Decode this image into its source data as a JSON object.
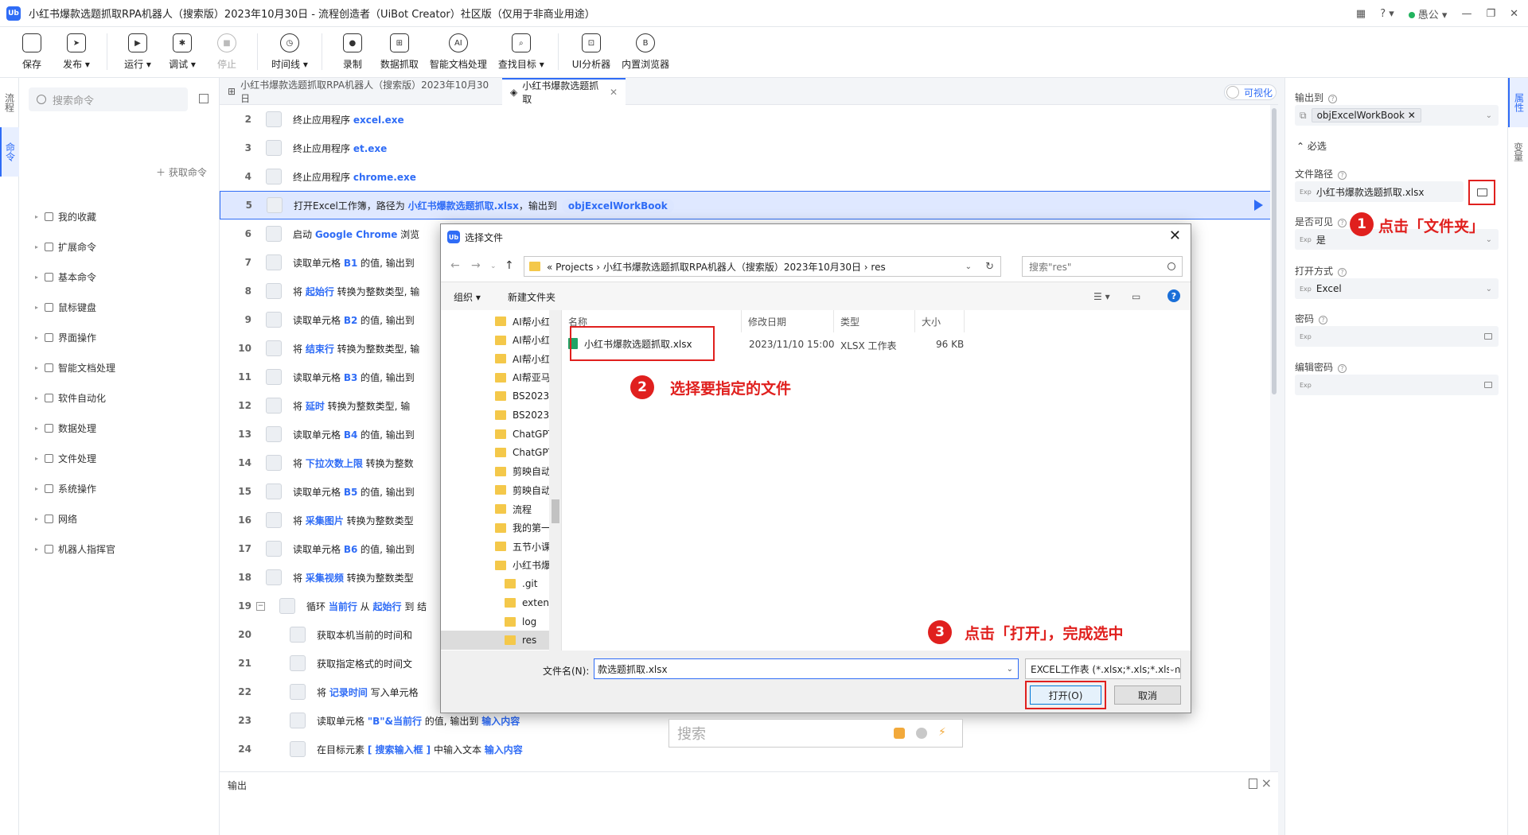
{
  "window": {
    "title": "小红书爆款选题抓取RPA机器人（搜索版）2023年10月30日 - 流程创造者（UiBot Creator）社区版（仅用于非商业用途）",
    "logo": "Ub",
    "user": "愚公"
  },
  "toolbar": {
    "save": "保存",
    "publish": "发布",
    "run": "运行",
    "debug": "调试",
    "stop": "停止",
    "timeline": "时间线",
    "record": "录制",
    "data_capture": "数据抓取",
    "smart_doc": "智能文档处理",
    "find_target": "查找目标",
    "ui_analyzer": "UI分析器",
    "builtin_browser": "内置浏览器"
  },
  "left_strip": {
    "flow": "流程",
    "commands": "命令"
  },
  "command_panel": {
    "search_placeholder": "搜索命令",
    "get_commands": "获取命令",
    "items": [
      "我的收藏",
      "扩展命令",
      "基本命令",
      "鼠标键盘",
      "界面操作",
      "智能文档处理",
      "软件自动化",
      "数据处理",
      "文件处理",
      "系统操作",
      "网络",
      "机器人指挥官"
    ]
  },
  "tabs": {
    "tab1": "小红书爆款选题抓取RPA机器人（搜索版）2023年10月30日",
    "tab2": "小红书爆款选题抓取",
    "visualize": "可视化"
  },
  "code_rows": [
    {
      "ln": "2",
      "pre": "终止应用程序 ",
      "v1": "excel.exe",
      "mid": "",
      "v2": "",
      "post": ""
    },
    {
      "ln": "3",
      "pre": "终止应用程序 ",
      "v1": "et.exe",
      "mid": "",
      "v2": "",
      "post": ""
    },
    {
      "ln": "4",
      "pre": "终止应用程序 ",
      "v1": "chrome.exe",
      "mid": "",
      "v2": "",
      "post": ""
    },
    {
      "ln": "5",
      "pre": "打开Excel工作簿，路径为 ",
      "v1": "小红书爆款选题抓取.xlsx",
      "mid": "，输出到",
      "v2": "",
      "post": ""
    },
    {
      "ln": "6",
      "pre": "启动 ",
      "v1": "Google Chrome",
      "mid": " 浏览",
      "v2": "",
      "post": ""
    },
    {
      "ln": "7",
      "pre": "读取单元格 ",
      "v1": "B1",
      "mid": " 的值, 输出到",
      "v2": "",
      "post": ""
    },
    {
      "ln": "8",
      "pre": "将 ",
      "v1": "起始行",
      "mid": " 转换为整数类型, 输",
      "v2": "",
      "post": ""
    },
    {
      "ln": "9",
      "pre": "读取单元格 ",
      "v1": "B2",
      "mid": " 的值, 输出到",
      "v2": "",
      "post": ""
    },
    {
      "ln": "10",
      "pre": "将 ",
      "v1": "结束行",
      "mid": " 转换为整数类型, 输",
      "v2": "",
      "post": ""
    },
    {
      "ln": "11",
      "pre": "读取单元格 ",
      "v1": "B3",
      "mid": " 的值, 输出到",
      "v2": "",
      "post": ""
    },
    {
      "ln": "12",
      "pre": "将 ",
      "v1": "延时",
      "mid": " 转换为整数类型, 输",
      "v2": "",
      "post": ""
    },
    {
      "ln": "13",
      "pre": "读取单元格 ",
      "v1": "B4",
      "mid": " 的值, 输出到",
      "v2": "",
      "post": ""
    },
    {
      "ln": "14",
      "pre": "将 ",
      "v1": "下拉次数上限",
      "mid": " 转换为整数",
      "v2": "",
      "post": ""
    },
    {
      "ln": "15",
      "pre": "读取单元格 ",
      "v1": "B5",
      "mid": " 的值, 输出到",
      "v2": "",
      "post": ""
    },
    {
      "ln": "16",
      "pre": "将 ",
      "v1": "采集图片",
      "mid": " 转换为整数类型",
      "v2": "",
      "post": ""
    },
    {
      "ln": "17",
      "pre": "读取单元格 ",
      "v1": "B6",
      "mid": " 的值, 输出到",
      "v2": "",
      "post": ""
    },
    {
      "ln": "18",
      "pre": "将 ",
      "v1": "采集视频",
      "mid": " 转换为整数类型",
      "v2": "",
      "post": ""
    },
    {
      "ln": "19",
      "pre": "循环 ",
      "v1": "当前行",
      "mid": " 从 ",
      "v2": "起始行",
      "post": " 到 结"
    },
    {
      "ln": "20",
      "pre": "获取本机当前的时间和",
      "v1": "",
      "mid": "",
      "v2": "",
      "post": ""
    },
    {
      "ln": "21",
      "pre": "获取指定格式的时间文",
      "v1": "",
      "mid": "",
      "v2": "",
      "post": ""
    },
    {
      "ln": "22",
      "pre": "将 ",
      "v1": "记录时间",
      "mid": " 写入单元格",
      "v2": "",
      "post": ""
    },
    {
      "ln": "23",
      "pre": "读取单元格 ",
      "v1": "\"B\"&当前行",
      "mid": " 的值, 输出到 ",
      "v2": "输入内容",
      "post": ""
    },
    {
      "ln": "24",
      "pre": "在目标元素 ",
      "v1": "[ 搜索输入框       ]",
      "mid": " 中输入文本 ",
      "v2": "输入内容",
      "post": ""
    }
  ],
  "row5_output": "objExcelWorkBook",
  "output_panel": {
    "label": "输出"
  },
  "properties": {
    "output_to_label": "输出到",
    "output_to_value": "objExcelWorkBook",
    "required_section": "必选",
    "file_path_label": "文件路径",
    "file_path_value": "小红书爆款选题抓取.xlsx",
    "visible_label": "是否可见",
    "visible_value": "是",
    "open_mode_label": "打开方式",
    "open_mode_value": "Excel",
    "password_label": "密码",
    "edit_password_label": "编辑密码",
    "exp": "Exp"
  },
  "right_strip": {
    "properties": "属性",
    "variables": "变量"
  },
  "dialog": {
    "title": "选择文件",
    "address": "«  Projects  ›  小红书爆款选题抓取RPA机器人（搜索版）2023年10月30日  ›  res",
    "search_placeholder": "搜索\"res\"",
    "organize": "组织 ▾",
    "new_folder": "新建文件夹",
    "tree": [
      "AI帮小红",
      "AI帮小红",
      "AI帮小红",
      "AI帮亚马",
      "BS2023",
      "BS2023",
      "ChatGPT",
      "ChatGPT",
      "剪映自动",
      "剪映自动",
      "流程",
      "我的第一",
      "五节小课",
      "小红书爆",
      ".git",
      "extend",
      "log",
      "res"
    ],
    "columns": {
      "name": "名称",
      "date": "修改日期",
      "type": "类型",
      "size": "大小"
    },
    "file": {
      "name": "小红书爆款选题抓取.xlsx",
      "date": "2023/11/10 15:00",
      "type": "XLSX 工作表",
      "size": "96 KB"
    },
    "filename_label": "文件名(N):",
    "filename_value": "款选题抓取.xlsx",
    "filetype_value": "EXCEL工作表 (*.xlsx;*.xls;*.xlsm)",
    "open_button": "打开(O)",
    "cancel_button": "取消"
  },
  "float_search": {
    "placeholder": "搜索"
  },
  "annotations": {
    "n1": "1",
    "t1": "点击「文件夹」",
    "n2": "2",
    "t2": "选择要指定的文件",
    "n3": "3",
    "t3": "点击「打开」，完成选中"
  }
}
